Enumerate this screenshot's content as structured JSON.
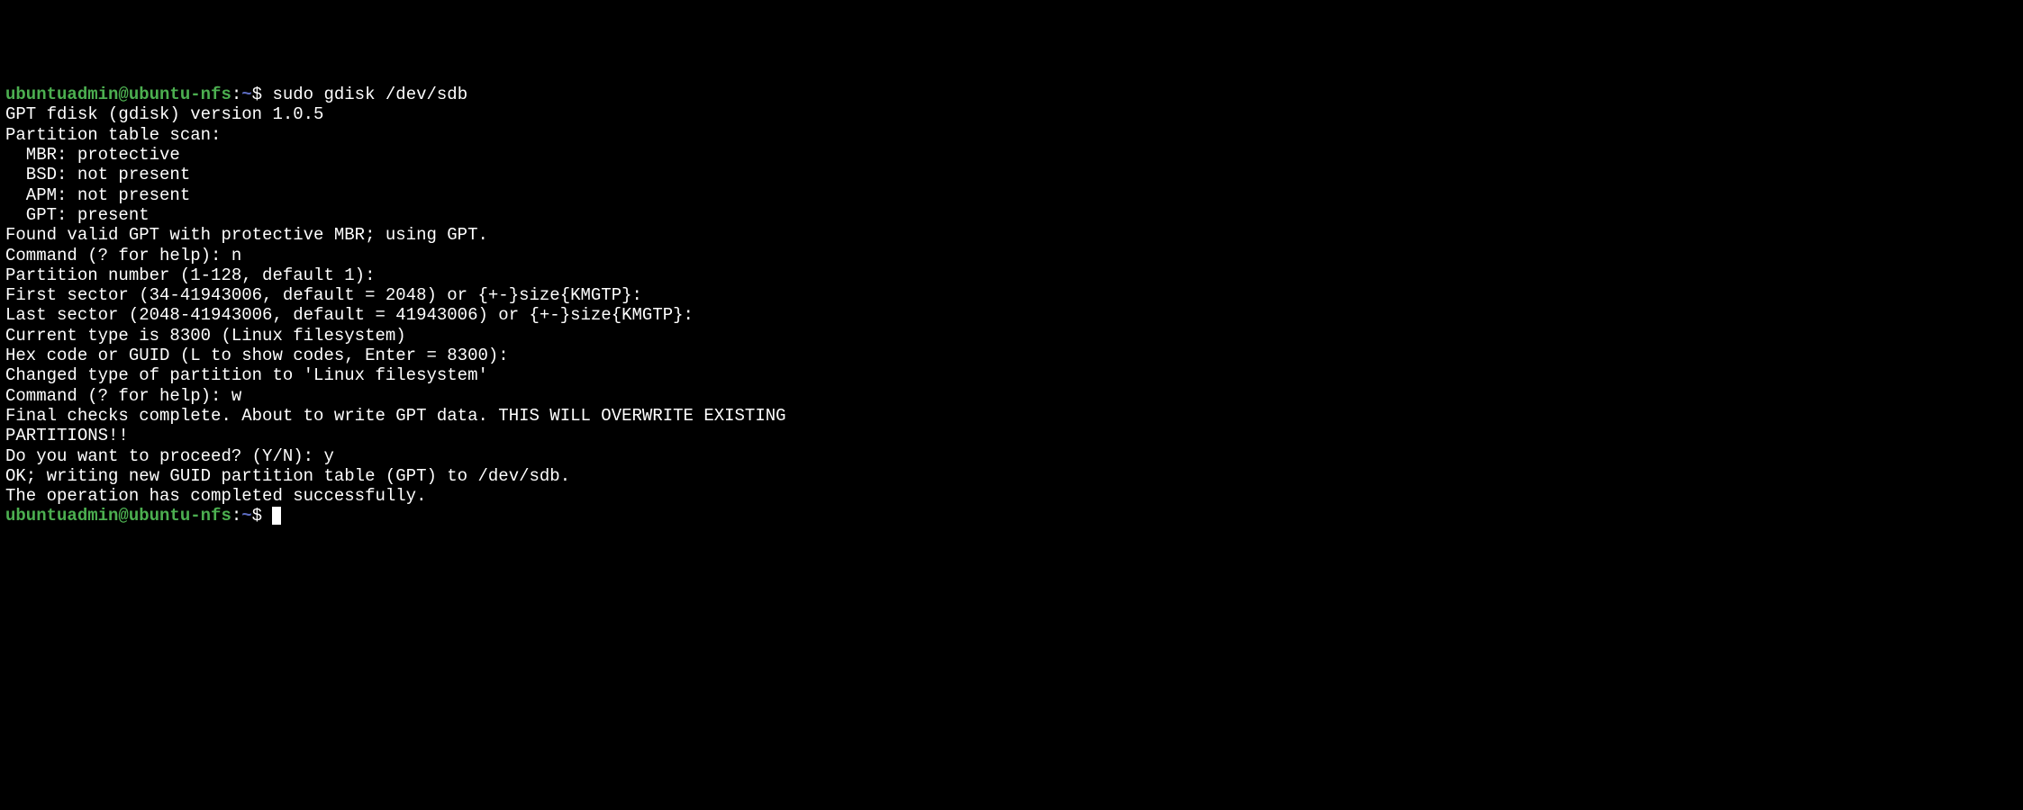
{
  "prompt1": {
    "user": "ubuntuadmin@ubuntu-nfs",
    "sep": ":",
    "path": "~",
    "dollar": "$ ",
    "command": "sudo gdisk /dev/sdb"
  },
  "lines": [
    "GPT fdisk (gdisk) version 1.0.5",
    "",
    "Partition table scan:",
    "  MBR: protective",
    "  BSD: not present",
    "  APM: not present",
    "  GPT: present",
    "",
    "Found valid GPT with protective MBR; using GPT.",
    "",
    "Command (? for help): n",
    "Partition number (1-128, default 1):",
    "First sector (34-41943006, default = 2048) or {+-}size{KMGTP}:",
    "Last sector (2048-41943006, default = 41943006) or {+-}size{KMGTP}:",
    "Current type is 8300 (Linux filesystem)",
    "Hex code or GUID (L to show codes, Enter = 8300):",
    "Changed type of partition to 'Linux filesystem'",
    "",
    "Command (? for help): w",
    "",
    "Final checks complete. About to write GPT data. THIS WILL OVERWRITE EXISTING",
    "PARTITIONS!!",
    "",
    "Do you want to proceed? (Y/N): y",
    "OK; writing new GUID partition table (GPT) to /dev/sdb.",
    "The operation has completed successfully."
  ],
  "prompt2": {
    "user": "ubuntuadmin@ubuntu-nfs",
    "sep": ":",
    "path": "~",
    "dollar": "$ "
  }
}
